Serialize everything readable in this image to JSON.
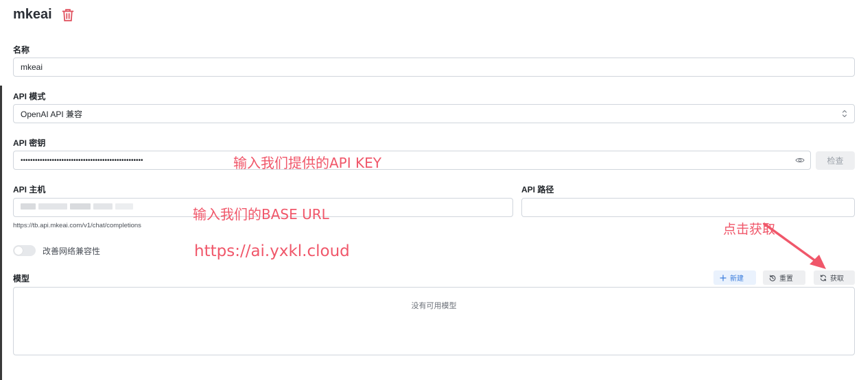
{
  "header": {
    "title": "mkeai"
  },
  "form": {
    "name": {
      "label": "名称",
      "value": "mkeai"
    },
    "api_mode": {
      "label": "API 模式",
      "value": "OpenAI API 兼容"
    },
    "api_key": {
      "label": "API 密钥",
      "value": "•••••••••••••••••••••••••••••••••••••••••••••••••••",
      "check_label": "检查"
    },
    "api_host": {
      "label": "API 主机",
      "value": "",
      "hint": "https://tb.api.mkeai.com/v1/chat/completions"
    },
    "api_path": {
      "label": "API 路径",
      "value": ""
    },
    "network_compat": {
      "label": "改善网络兼容性",
      "enabled": false
    }
  },
  "models": {
    "label": "模型",
    "new_label": "新建",
    "reset_label": "重置",
    "fetch_label": "获取",
    "empty_text": "没有可用模型"
  },
  "annotations": {
    "api_key_note": "输入我们提供的API KEY",
    "base_url_note": "输入我们的BASE URL",
    "url_note": "https://ai.yxkl.cloud",
    "fetch_note": "点击获取"
  },
  "colors": {
    "accent": "#3b7ddd",
    "annotation": "#f0576a",
    "danger": "#e0525f"
  },
  "icons": {
    "trash": "trash-icon",
    "eye": "eye-icon",
    "plus": "plus-icon",
    "reset": "reset-icon",
    "refresh": "refresh-icon"
  }
}
